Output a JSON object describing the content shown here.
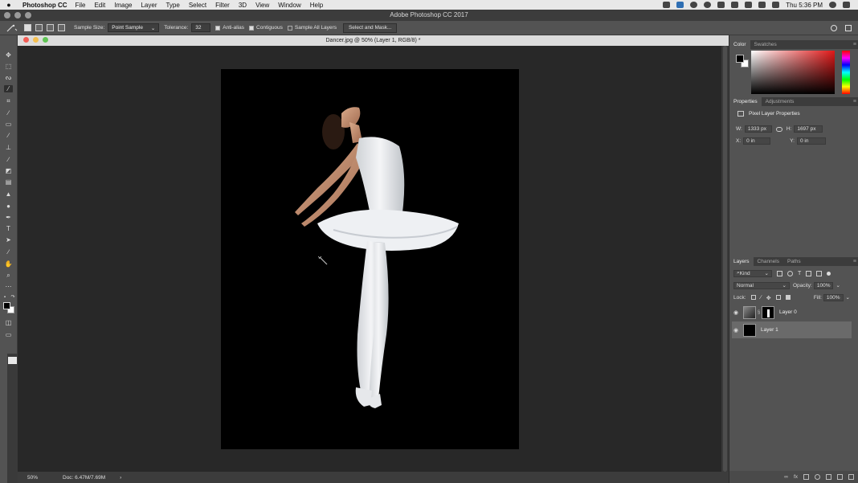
{
  "menubar": {
    "apple": "",
    "app_name": "Photoshop CC",
    "items": [
      "File",
      "Edit",
      "Image",
      "Layer",
      "Type",
      "Select",
      "Filter",
      "3D",
      "View",
      "Window",
      "Help"
    ],
    "clock": "Thu 5:36 PM"
  },
  "app_title": "Adobe Photoshop CC 2017",
  "options": {
    "sample_size_label": "Sample Size:",
    "sample_size_value": "Point Sample",
    "tolerance_label": "Tolerance:",
    "tolerance_value": "32",
    "anti_alias_label": "Anti-alias",
    "contiguous_label": "Contiguous",
    "sample_all_layers_label": "Sample All Layers",
    "select_and_mask_label": "Select and Mask..."
  },
  "document": {
    "tab_title": "Dancer.jpg @ 50% (Layer 1, RGB/8) *",
    "zoom": "50%",
    "doc_size": "Doc: 6.47M/7.69M"
  },
  "panels": {
    "color_tabs": [
      "Color",
      "Swatches"
    ],
    "properties_tabs": [
      "Properties",
      "Adjustments"
    ],
    "properties_title": "Pixel Layer Properties",
    "w_label": "W:",
    "w_value": "1333 px",
    "h_label": "H:",
    "h_value": "1697 px",
    "x_label": "X:",
    "x_value": "0 in",
    "y_label": "Y:",
    "y_value": "0 in",
    "layers_tabs": [
      "Layers",
      "Channels",
      "Paths"
    ],
    "kind_label": "Kind",
    "blend_mode": "Normal",
    "opacity_label": "Opacity:",
    "opacity_value": "100%",
    "lock_label": "Lock:",
    "fill_label": "Fill:",
    "fill_value": "100%",
    "layers": [
      {
        "name": "Layer 0",
        "visible": true,
        "selected": false
      },
      {
        "name": "Layer 1",
        "visible": true,
        "selected": true
      }
    ],
    "footer_fx": "fx"
  },
  "colors": {
    "accent_red": "#e01818",
    "selected_layer": "#6a6a6a",
    "canvas_bg": "#000000"
  }
}
